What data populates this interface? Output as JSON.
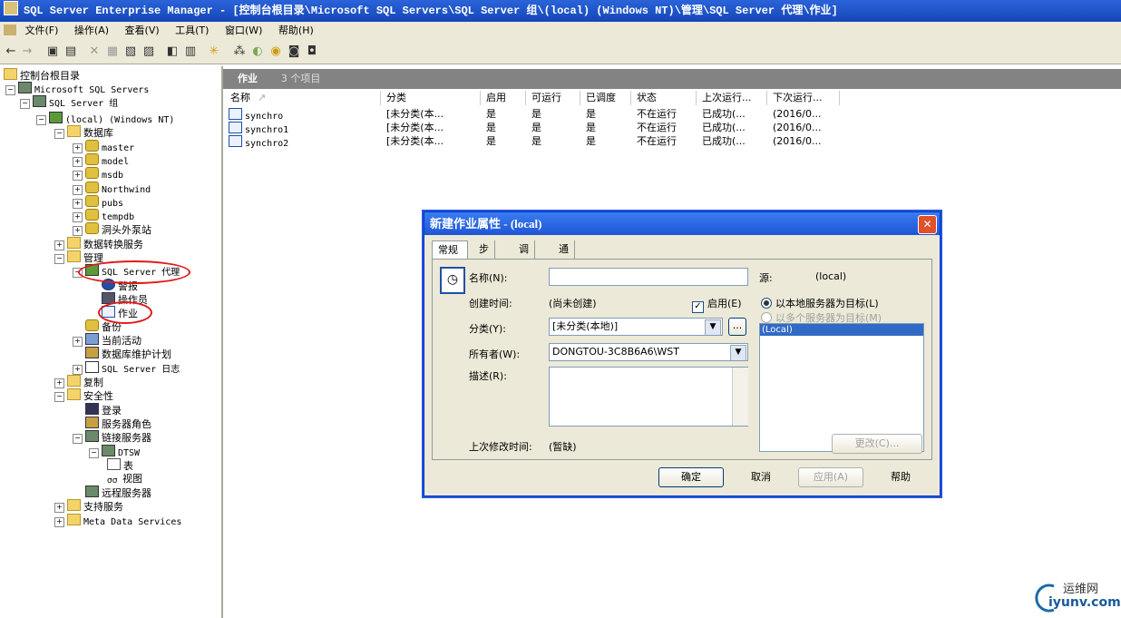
{
  "window": {
    "title": "SQL Server Enterprise Manager - [控制台根目录\\Microsoft SQL Servers\\SQL Server 组\\(local) (Windows NT)\\管理\\SQL Server 代理\\作业]"
  },
  "menu": [
    "文件(F)",
    "操作(A)",
    "查看(V)",
    "工具(T)",
    "窗口(W)",
    "帮助(H)"
  ],
  "toolbar_icons": [
    "back-arrow-icon",
    "forward-arrow-icon",
    "up-folder-icon",
    "show-tree-icon",
    "delete-icon",
    "properties-icon",
    "refresh-icon",
    "export-icon",
    "register-icon",
    "wizard-icon",
    "new-icon",
    "star-icon",
    "query-icon",
    "database-icon",
    "job-icon",
    "schedule-icon"
  ],
  "tree": {
    "root": "控制台根目录",
    "servers": "Microsoft SQL Servers",
    "group": "SQL Server 组",
    "local": "(local) (Windows NT)",
    "databases": "数据库",
    "db_items": [
      "master",
      "model",
      "msdb",
      "Northwind",
      "pubs",
      "tempdb",
      "洞头外泵站"
    ],
    "dts": "数据转换服务",
    "management": "管理",
    "agent": "SQL Server 代理",
    "alerts": "警报",
    "operators": "操作员",
    "jobs": "作业",
    "backup": "备份",
    "current_activity": "当前活动",
    "maint_plans": "数据库维护计划",
    "sql_logs": "SQL Server 日志",
    "replication": "复制",
    "security": "安全性",
    "logins": "登录",
    "server_roles": "服务器角色",
    "linked_servers": "链接服务器",
    "dtsw": "DTSW",
    "tables": "表",
    "views": "视图",
    "remote_servers": "远程服务器",
    "support_services": "支持服务",
    "meta_data": "Meta Data Services"
  },
  "right_pane": {
    "title": "作业",
    "count": "3 个项目",
    "columns": [
      "名称",
      "分类",
      "启用",
      "可运行",
      "已调度",
      "状态",
      "上次运行...",
      "下次运行..."
    ],
    "rows": [
      {
        "name": "synchro",
        "category": "[未分类(本...",
        "enabled": "是",
        "runnable": "是",
        "scheduled": "是",
        "status": "不在运行",
        "last_run": "已成功(...",
        "next_run": "(2016/0..."
      },
      {
        "name": "synchro1",
        "category": "[未分类(本...",
        "enabled": "是",
        "runnable": "是",
        "scheduled": "是",
        "status": "不在运行",
        "last_run": "已成功(...",
        "next_run": "(2016/0..."
      },
      {
        "name": "synchro2",
        "category": "[未分类(本...",
        "enabled": "是",
        "runnable": "是",
        "scheduled": "是",
        "status": "不在运行",
        "last_run": "已成功(...",
        "next_run": "(2016/0..."
      }
    ]
  },
  "dialog": {
    "title": "新建作业属性 - (local)",
    "tabs": [
      "常规",
      "步骤",
      "调度",
      "通知"
    ],
    "name_label": "名称(N):",
    "name_value": "",
    "source_label": "源:",
    "source_value": "(local)",
    "created_label": "创建时间:",
    "created_value": "(尚未创建)",
    "enabled_label": "启用(E)",
    "enabled_checked": true,
    "category_label": "分类(Y):",
    "category_value": "[未分类(本地)]",
    "category_more": "...",
    "owner_label": "所有者(W):",
    "owner_value": "DONGTOU-3C8B6A6\\WST",
    "desc_label": "描述(R):",
    "desc_value": "",
    "target_local": "以本地服务器为目标(L)",
    "target_multi": "以多个服务器为目标(M)",
    "target_list": [
      "(Local)"
    ],
    "change_button": "更改(C)...",
    "modified_label": "上次修改时间:",
    "modified_value": "(暂缺)",
    "buttons": {
      "ok": "确定",
      "cancel": "取消",
      "apply": "应用(A)",
      "help": "帮助"
    }
  },
  "watermark": {
    "cn": "运维网",
    "en": "iyunv.com"
  },
  "colors": {
    "title_bar": "#1f55d6",
    "highlight_ring": "#e21a1a",
    "selection": "#316ac5",
    "pane_header": "#838383"
  }
}
